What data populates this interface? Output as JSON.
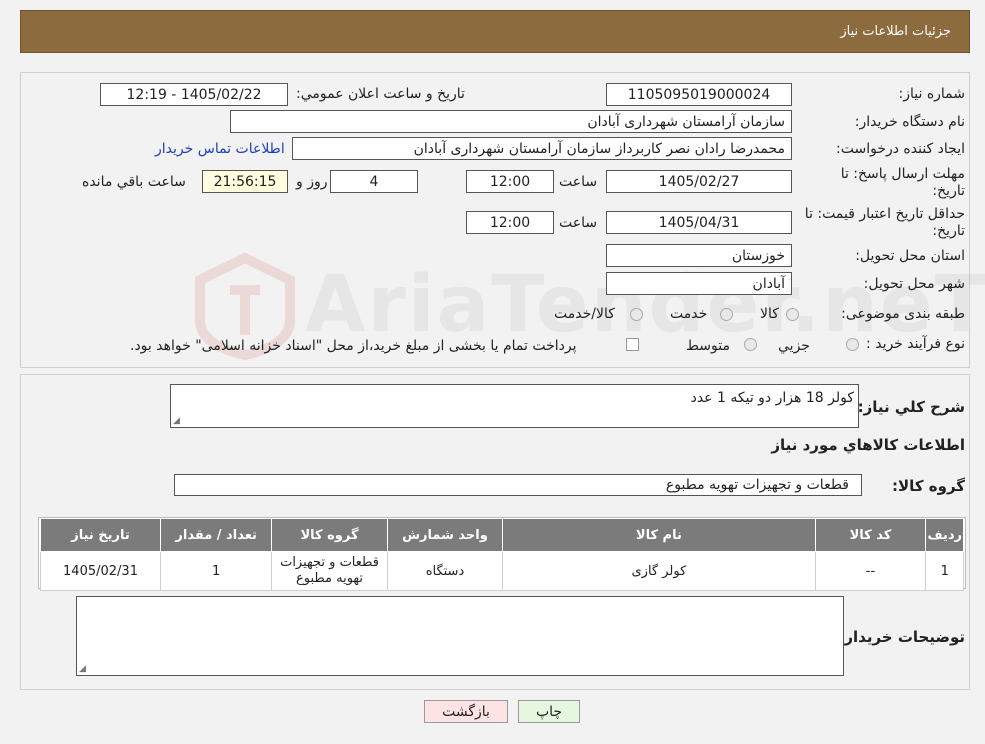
{
  "header": {
    "title": "جزئیات اطلاعات نیاز"
  },
  "form": {
    "need_number_label": "شماره نیاز:",
    "need_number": "1105095019000024",
    "announce_label": "تاریخ و ساعت اعلان عمومي:",
    "announce_value": "1405/02/22 - 12:19",
    "buyer_org_label": "نام دستگاه خریدار:",
    "buyer_org": "سازمان آرامستان شهرداری آبادان",
    "creator_label": "ایجاد کننده درخواست:",
    "creator": "محمدرضا رادان نصر کاربرداز سازمان آرامستان شهرداری آبادان",
    "contact_link": "اطلاعات تماس خریدار",
    "reply_deadline_label": "مهلت ارسال پاسخ: تا تاریخ:",
    "reply_date": "1405/02/27",
    "time_label": "ساعت",
    "reply_time": "12:00",
    "days_value": "4",
    "days_label": "روز و",
    "remaining_time": "21:56:15",
    "remaining_label": "ساعت باقي مانده",
    "min_validity_label": "حداقل تاریخ اعتبار قیمت: تا تاریخ:",
    "validity_date": "1405/04/31",
    "validity_time": "12:00",
    "province_label": "استان محل تحویل:",
    "province": "خوزستان",
    "city_label": "شهر محل تحویل:",
    "city": "آبادان",
    "category_label": "طبقه بندی موضوعی:",
    "category_options": [
      "کالا",
      "خدمت",
      "کالا/خدمت"
    ],
    "process_label": "نوع فرآیند خرید :",
    "process_options": [
      "جزیي",
      "متوسط"
    ],
    "payment_note": "پرداخت تمام یا بخشی از مبلغ خرید،از محل \"اسناد خزانه اسلامی\" خواهد بود."
  },
  "details": {
    "summary_label": "شرح کلي نیاز:",
    "summary": "کولر 18 هزار دو تیکه 1 عدد",
    "goods_info_title": "اطلاعات کالاهاي مورد نیاز",
    "goods_group_label": "گروه کالا:",
    "goods_group": "قطعات و تجهیزات تهویه مطبوع",
    "table": {
      "headers": [
        "ردیف",
        "کد کالا",
        "نام کالا",
        "واحد شمارش",
        "گروه کالا",
        "تعداد / مقدار",
        "تاریخ نیاز"
      ],
      "rows": [
        [
          "1",
          "--",
          "کولر گازی",
          "دستگاه",
          "قطعات و تجهیزات تهویه مطبوع",
          "1",
          "1405/02/31"
        ]
      ]
    },
    "buyer_notes_label": "توضیحات خریدار:",
    "buyer_notes": ""
  },
  "buttons": {
    "print": "چاپ",
    "back": "بازگشت"
  },
  "watermark": {
    "text": "AriaTender.neT"
  },
  "colors": {
    "header_bg": "#8c6b3f",
    "table_header_bg": "#7b7b7b",
    "back_btn_bg": "#fde3e3",
    "print_btn_bg": "#e6f7e0"
  }
}
